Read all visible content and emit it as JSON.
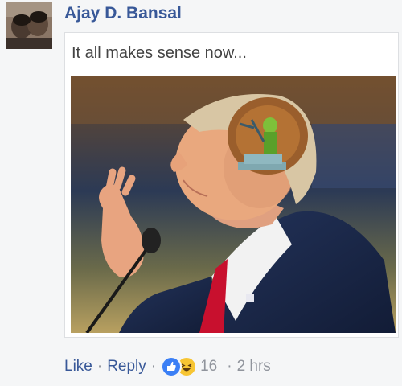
{
  "comment": {
    "author": "Ajay D. Bansal",
    "caption": "It all makes sense now...",
    "actions": {
      "like_label": "Like",
      "reply_label": "Reply",
      "separator": "·",
      "reaction_count": "16",
      "timestamp": "2 hrs"
    },
    "reactions": [
      "like-icon",
      "haha-icon"
    ]
  },
  "colors": {
    "author_link": "#385898",
    "meta_text": "#90949c",
    "like_reaction": "#3b7ff5",
    "haha_reaction": "#f7c533"
  }
}
